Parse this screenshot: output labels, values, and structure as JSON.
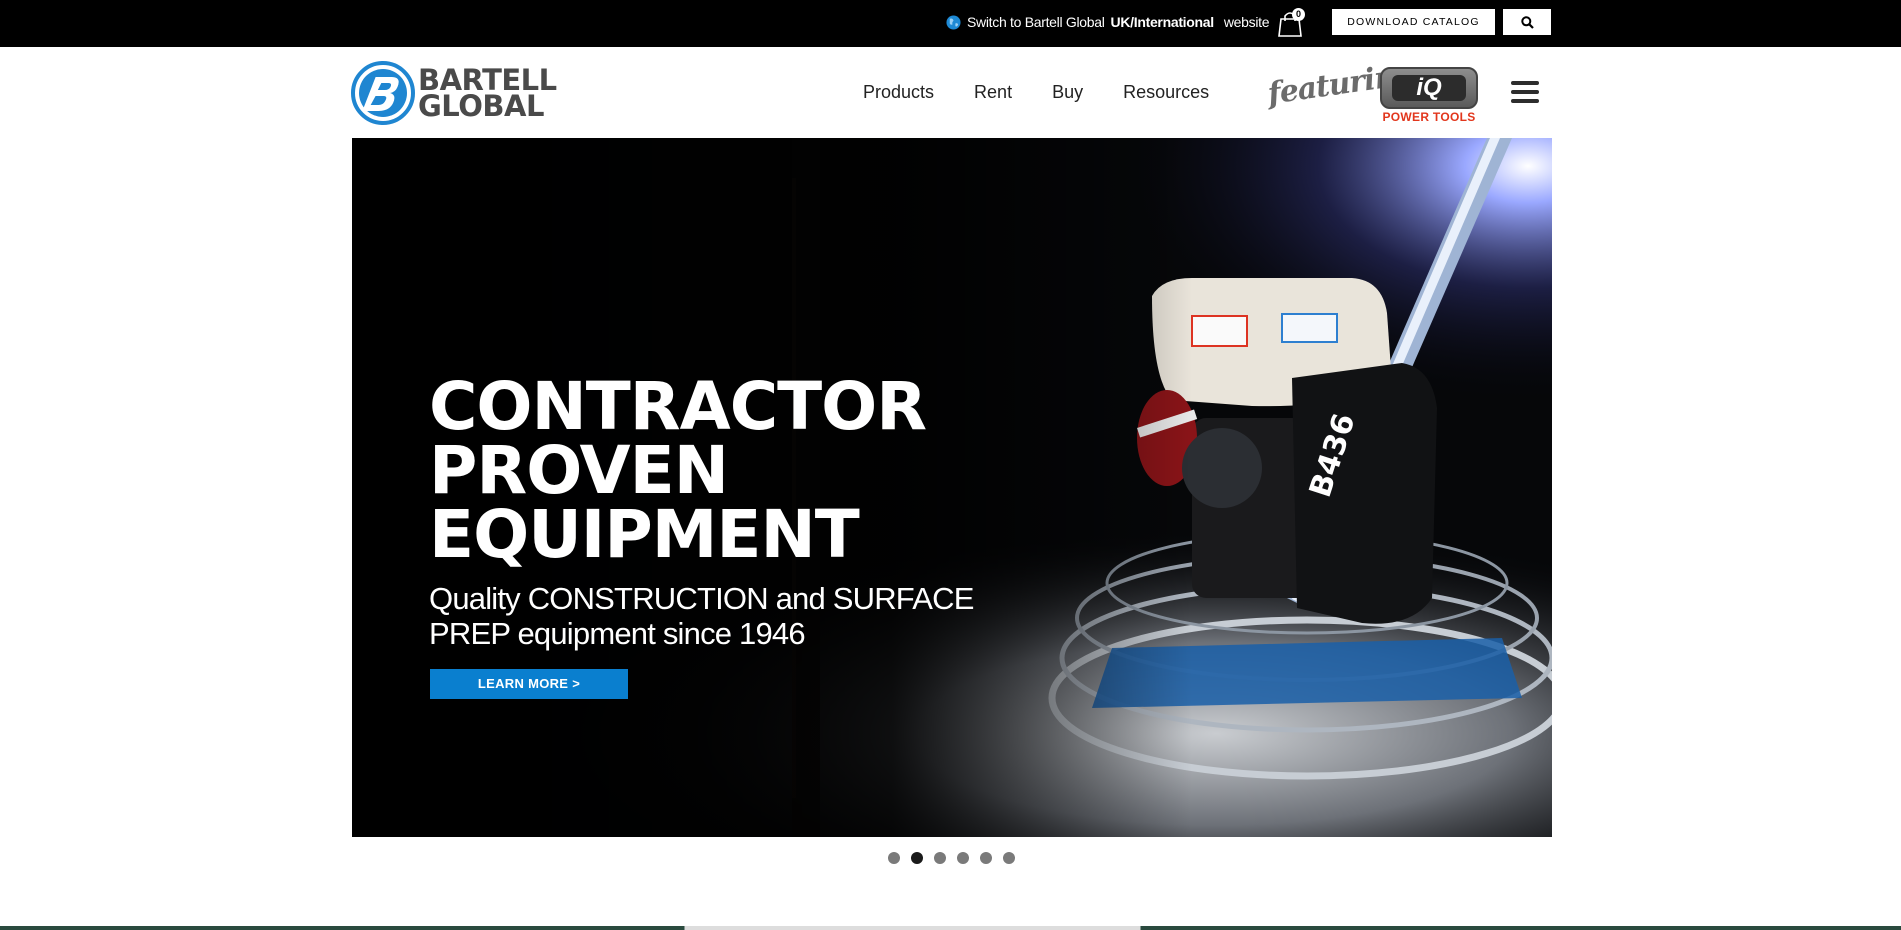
{
  "topbar": {
    "switch_prefix": "Switch to Bartell Global",
    "switch_region": "UK/International",
    "switch_suffix": "website",
    "cart_count": "0",
    "catalog_label": "DOWNLOAD CATALOG",
    "search_icon": "search-icon"
  },
  "header": {
    "logo_line1": "BARTELL",
    "logo_line2": "GLOBAL",
    "nav": [
      "Products",
      "Rent",
      "Buy",
      "Resources"
    ],
    "featuring": "featuring",
    "iq_logo": "iQ",
    "iq_sub": "POWER TOOLS"
  },
  "hero": {
    "title": "CONTRACTOR PROVEN EQUIPMENT",
    "subtitle": "Quality CONSTRUCTION and SURFACE PREP equipment since 1946",
    "button": "LEARN MORE >",
    "machine_label": "B436"
  },
  "carousel": {
    "slide_count": 6,
    "active_index": 1
  },
  "colors": {
    "accent_blue": "#0a7fcf",
    "topbar": "#000000",
    "iq_red": "#e2361c"
  }
}
